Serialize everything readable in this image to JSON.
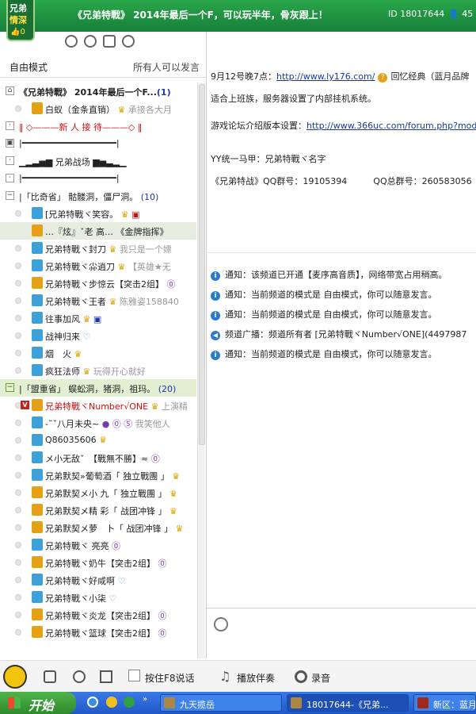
{
  "header": {
    "logo_line1": "兄弟",
    "logo_line2": "情深",
    "logo_count": "0",
    "title": "《兄弟特戰》 2014年最后一个F，可以玩半年，骨灰跟上！",
    "id_text": "ID 18017644",
    "user_count": "45"
  },
  "toolbar": {
    "icons": [
      "users-icon",
      "location-icon",
      "list-icon",
      "search-icon"
    ]
  },
  "mode": {
    "left": "自由模式",
    "right": "所有人可以发言"
  },
  "tree": {
    "rows": [
      {
        "type": "channel",
        "text": "《兄弟特戰》 2014年最后一个F...",
        "count": "(1)"
      },
      {
        "type": "user",
        "name": "白蚁（金条直销）",
        "badge": "♛",
        "extra": "承接各大月"
      },
      {
        "type": "channel",
        "text": "‖ ◇———新 人 接 待———◇ ‖"
      },
      {
        "type": "channel",
        "text": "|━━━━━━━━━━━━━━━━━━|"
      },
      {
        "type": "channel",
        "text": "▁▂▃▅▆ 兄弟战场 ▆▅▃▂▁"
      },
      {
        "type": "channel",
        "text": "|━━━━━━━━━━━━━━━━━━|"
      },
      {
        "type": "channel",
        "text": "|「比奇省」 骷髅洞，僵尸洞。",
        "count": "(10)"
      },
      {
        "type": "user",
        "name": "[兄弟特戰ヾ笑容。",
        "badge": "♛",
        "extra": "▣"
      },
      {
        "type": "user",
        "name": "…『炫』ˇ老 高…  《金牌指挥》",
        "badge": "",
        "extra": ""
      },
      {
        "type": "user",
        "name": "兄弟特戰ヾ封刀",
        "badge": "♛",
        "extra": "我只是一个嫖"
      },
      {
        "type": "user",
        "name": "兄弟特戰ヾ尛逍刀",
        "badge": "♛",
        "extra": "【英雄★无"
      },
      {
        "type": "user",
        "name": "兄弟特戰ヾ步惊云【突击2组】",
        "badge": "⓪",
        "extra": ""
      },
      {
        "type": "user",
        "name": "兄弟特戰ヾ王者",
        "badge": "♛",
        "extra": "陈雅姿158840"
      },
      {
        "type": "user",
        "name": "往事加风",
        "badge": "♛",
        "extra": "▣"
      },
      {
        "type": "user",
        "name": "战神归来",
        "badge": "♡",
        "extra": ""
      },
      {
        "type": "user",
        "name": "烟　火",
        "badge": "♛",
        "extra": ""
      },
      {
        "type": "user",
        "name": "疯狂法师",
        "badge": "♛",
        "extra": "玩得开心就好"
      },
      {
        "type": "channel",
        "text": "|「盟重省」 蜈蚣洞，猪洞，祖玛。",
        "count": "(20)"
      },
      {
        "type": "user",
        "name": "兄弟特戰ヾNumber√ONE",
        "badge": "♛",
        "extra": "上演精"
      },
      {
        "type": "user",
        "name": "-˜ˇ八月未央~",
        "badge": "● ⓪ Ⓢ",
        "extra": "我笑他人"
      },
      {
        "type": "user",
        "name": "Q86035606",
        "badge": "♛",
        "extra": ""
      },
      {
        "type": "user",
        "name": "メ小无敌ˇ　【戰無不勝】≈",
        "badge": "⓪",
        "extra": ""
      },
      {
        "type": "user",
        "name": "兄弟默契»葡萄酒「 独立戰團 」",
        "badge": "♛",
        "extra": ""
      },
      {
        "type": "user",
        "name": "兄弟默契メ小 九「 独立戰團 」",
        "badge": "♛",
        "extra": ""
      },
      {
        "type": "user",
        "name": "兄弟默契メ精 彩「 战团冲锋 」",
        "badge": "♛",
        "extra": ""
      },
      {
        "type": "user",
        "name": "兄弟默契メ萝　卜「 战团冲锋 」",
        "badge": "♛",
        "extra": ""
      },
      {
        "type": "user",
        "name": "兄弟特戰ヾ 亮亮",
        "badge": "⓪",
        "extra": ""
      },
      {
        "type": "user",
        "name": "兄弟特戰ヾ奶牛【突击2组】",
        "badge": "⓪",
        "extra": ""
      },
      {
        "type": "user",
        "name": "兄弟特戰ヾ好咸啊",
        "badge": "♡",
        "extra": ""
      },
      {
        "type": "user",
        "name": "兄弟特戰ヾ小柒",
        "badge": "♡",
        "extra": ""
      },
      {
        "type": "user",
        "name": "兄弟特戰ヾ炎龙【突击2组】",
        "badge": "⓪",
        "extra": ""
      },
      {
        "type": "user",
        "name": "兄弟特戰ヾ篮球【突击2组】",
        "badge": "⓪",
        "extra": ""
      }
    ]
  },
  "bulletin": {
    "line1_prefix": "9月12号晚7点：",
    "line1_link": "http://www.ly176.com/",
    "line1_suffix": "回忆经典（蓝月品牌",
    "line2": "适合上班族，服务器设置了内部挂机系统。",
    "line3_prefix": "游戏论坛介绍版本设置：",
    "line3_link": "http://www.366uc.com/forum.php?mod",
    "line4": "YY统一马甲：兄弟特戰ヾ名字",
    "line5": "《兄弟特战》QQ群号：19105394　　　QQ总群号：260583056"
  },
  "messages": [
    {
      "icon": "info",
      "text": "通知：该频道已开通【麦序高音质】，网络带宽占用稍高。"
    },
    {
      "icon": "info",
      "text": "通知：当前频道的模式是 自由模式，你可以随意发言。"
    },
    {
      "icon": "info",
      "text": "通知：当前频道的模式是 自由模式，你可以随意发言。"
    },
    {
      "icon": "speaker",
      "text": "频道广播：频道所有者 [兄弟特戰ヾNumber√ONE](4497987"
    },
    {
      "icon": "info",
      "text": "通知：当前频道的模式是 自由模式，你可以随意发言。"
    }
  ],
  "bottombar": {
    "ptt_label": "按住F8说话",
    "music_label": "播放伴奏",
    "record_label": "录音"
  },
  "taskbar": {
    "start": "开始",
    "tasks": [
      "九天揽岳",
      "18017644-《兄弟...",
      "新区：蓝月"
    ]
  }
}
